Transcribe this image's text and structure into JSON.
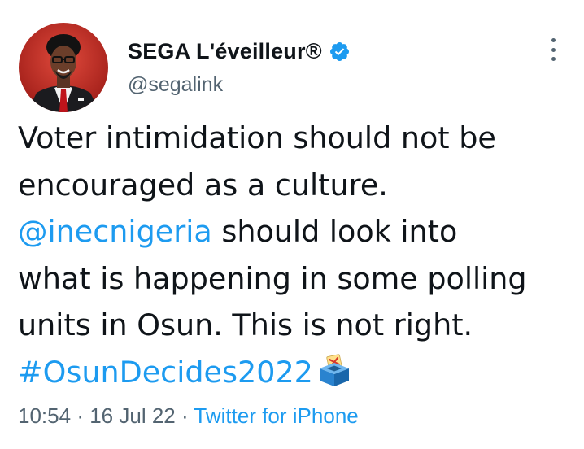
{
  "author": {
    "display_name": "SEGA L'éveilleur®",
    "handle": "@segalink",
    "verified": true,
    "verified_color": "#1d9bf0"
  },
  "tweet": {
    "lines": [
      {
        "text": "Voter intimidation should not be"
      },
      {
        "text": "encouraged as a culture."
      },
      {
        "mention": "@inecnigeria",
        "text": " should look into"
      },
      {
        "text": "what is happening in some polling"
      },
      {
        "text": "units in Osun. This is not right."
      },
      {
        "hashtag": "#OsunDecides2022",
        "emoji": "ballot-box-icon"
      }
    ]
  },
  "meta": {
    "time": "10:54",
    "separator": "·",
    "date": "16 Jul 22",
    "source": "Twitter for iPhone"
  },
  "icons": {
    "more": "more-vertical-icon",
    "verified": "verified-badge-icon",
    "avatar": "profile-avatar"
  },
  "colors": {
    "link": "#1d9bf0",
    "secondary_text": "#536471",
    "avatar_bg": "#c0392b"
  }
}
